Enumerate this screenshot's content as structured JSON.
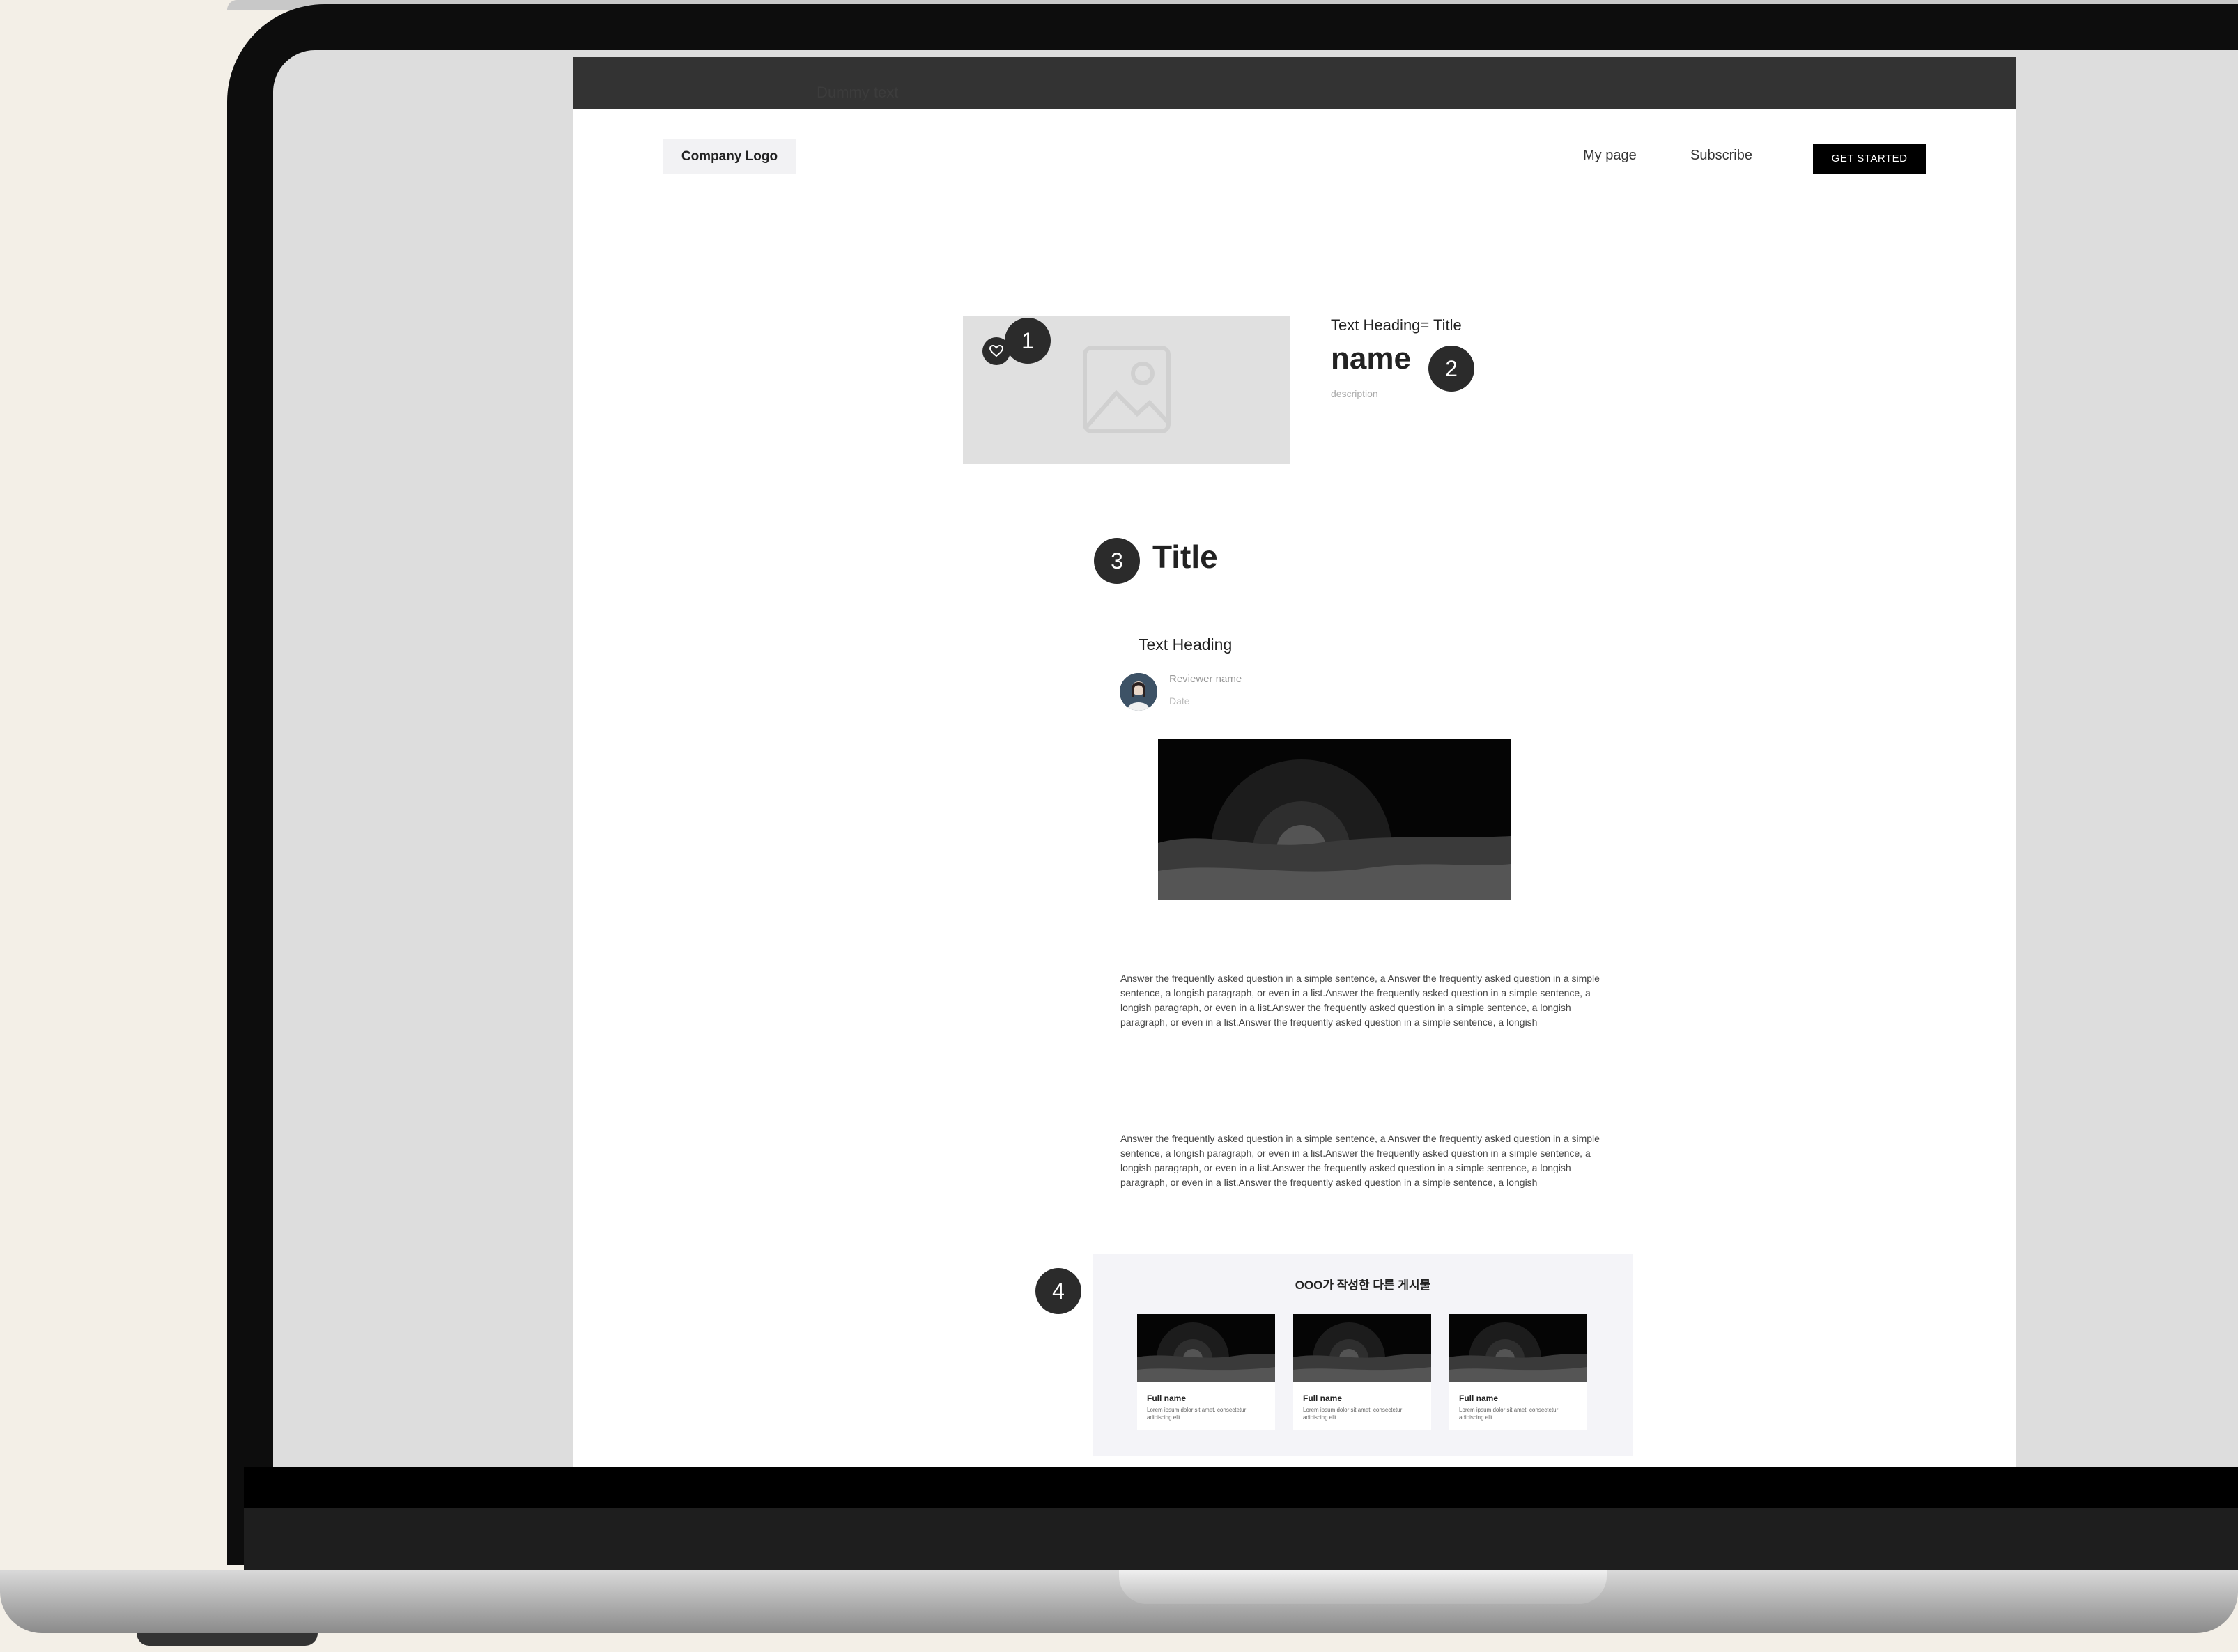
{
  "topbar": {
    "text": "Dummy text"
  },
  "header": {
    "logo": "Company Logo",
    "nav": [
      "My page",
      "Subscribe"
    ],
    "cta": "GET STARTED"
  },
  "markers": [
    "1",
    "2",
    "3",
    "4"
  ],
  "hero": {
    "heading": "Text Heading= Title",
    "name": "name",
    "description": "description"
  },
  "review": {
    "title": "Title",
    "text_heading": "Text Heading",
    "reviewer_name": "Reviewer name",
    "date": "Date",
    "paragraphs": [
      "Answer the frequently asked question in a simple sentence, a Answer the frequently asked question in a simple sentence, a longish paragraph, or even in a list.Answer the frequently asked question in a simple sentence, a longish paragraph, or even in a list.Answer the frequently asked question in a simple sentence, a longish paragraph, or even in a list.Answer the frequently asked question in a simple sentence, a longish",
      "Answer the frequently asked question in a simple sentence, a Answer the frequently asked question in a simple sentence, a longish paragraph, or even in a list.Answer the frequently asked question in a simple sentence, a longish paragraph, or even in a list.Answer the frequently asked question in a simple sentence, a longish paragraph, or even in a list.Answer the frequently asked question in a simple sentence, a longish"
    ]
  },
  "other_posts": {
    "title": "OOO가 작성한 다른 게시물",
    "cards": [
      {
        "name": "Full name",
        "desc": "Lorem ipsum dolor sit amet, consectetur adipiscing elit."
      },
      {
        "name": "Full name",
        "desc": "Lorem ipsum dolor sit amet, consectetur adipiscing elit."
      },
      {
        "name": "Full name",
        "desc": "Lorem ipsum dolor sit amet, consectetur adipiscing elit."
      }
    ]
  },
  "colors": {
    "marker": "#2b2b2b",
    "cta_bg": "#000000",
    "topbar": "#333333"
  },
  "icons": [
    "heart-icon",
    "image-placeholder-icon"
  ]
}
